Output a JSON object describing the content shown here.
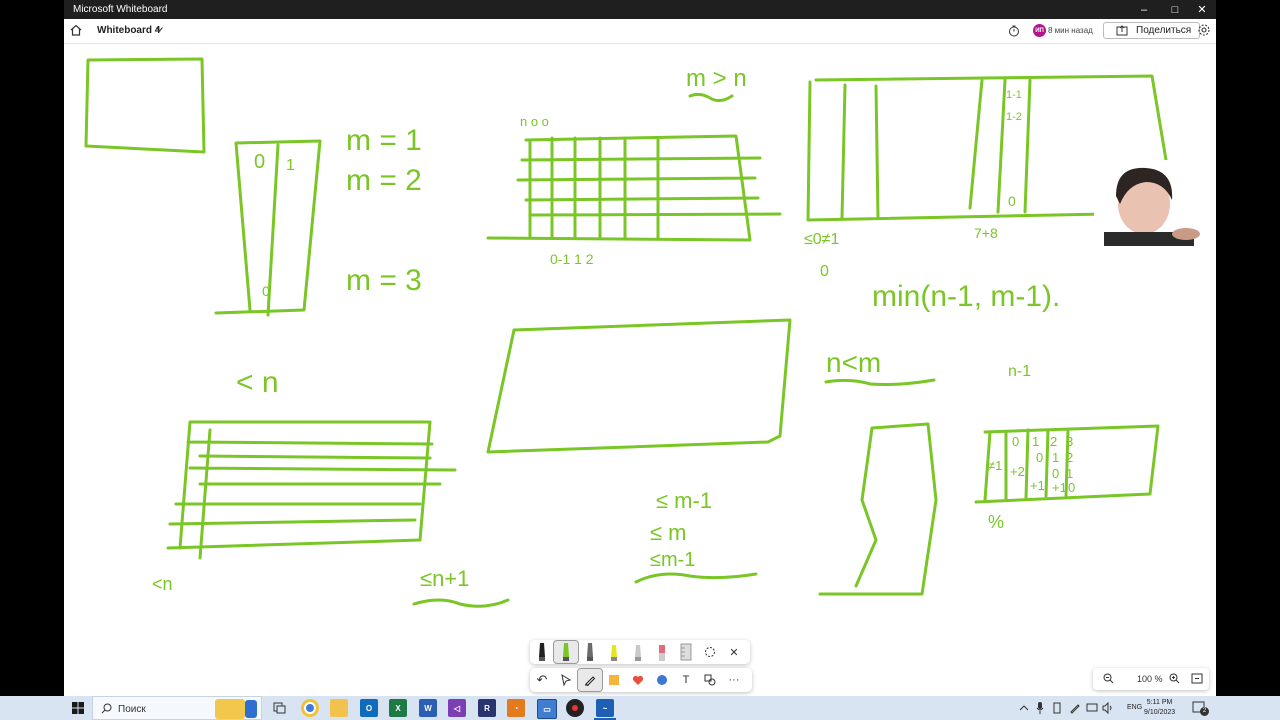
{
  "window": {
    "title": "Microsoft Whiteboard",
    "minimize": "–",
    "maximize": "□",
    "close": "✕"
  },
  "appbar": {
    "board_name": "Whiteboard 4",
    "avatar_initials": "ИП",
    "last_modified": "8 мин назад",
    "share_label": "Поделиться"
  },
  "ink": {
    "color": "#7ac626",
    "annotations": {
      "m1": "m = 1",
      "m2": "m = 2",
      "m3": "m = 3",
      "m_gt_n": "m > n",
      "n_lt_m": "n<m",
      "lt_n": "< n",
      "lt_n_small": "<n",
      "le_n1": "≤n+1",
      "le_m1": "≤ m-1",
      "le_m": "≤ m",
      "le_m1b": "≤m-1",
      "min_formula": "min(n-1, m-1).",
      "n_minus_1": "n-1",
      "grid_top": "n o o",
      "grid_bottom": "0-1 1 2",
      "col_labels_a": "1-1",
      "col_labels_b": "1-2",
      "zero_a": "0",
      "zero_b": "0",
      "zero_c": "0",
      "col_0": "0",
      "col_1": "1",
      "le0": "≤0≠1",
      "right_bottom": "7+8",
      "percent": "%"
    },
    "small_table": {
      "row1": [
        "0",
        "1",
        "2",
        "3"
      ],
      "row2": [
        "≠1",
        "0",
        "1",
        "2"
      ],
      "row3": [
        "+2",
        "+1",
        "0",
        "1"
      ],
      "row4": [
        "",
        "",
        "+1",
        "0"
      ]
    }
  },
  "pen_toolbar": {
    "close": "✕"
  },
  "action_toolbar": {
    "undo": "↶",
    "more": "···",
    "text_tool": "T"
  },
  "zoom": {
    "level": "100 %"
  },
  "taskbar": {
    "search_placeholder": "Поиск",
    "language": "ENG",
    "time": "5:11 PM",
    "date": "9/10/2023",
    "notification_count": "2"
  }
}
